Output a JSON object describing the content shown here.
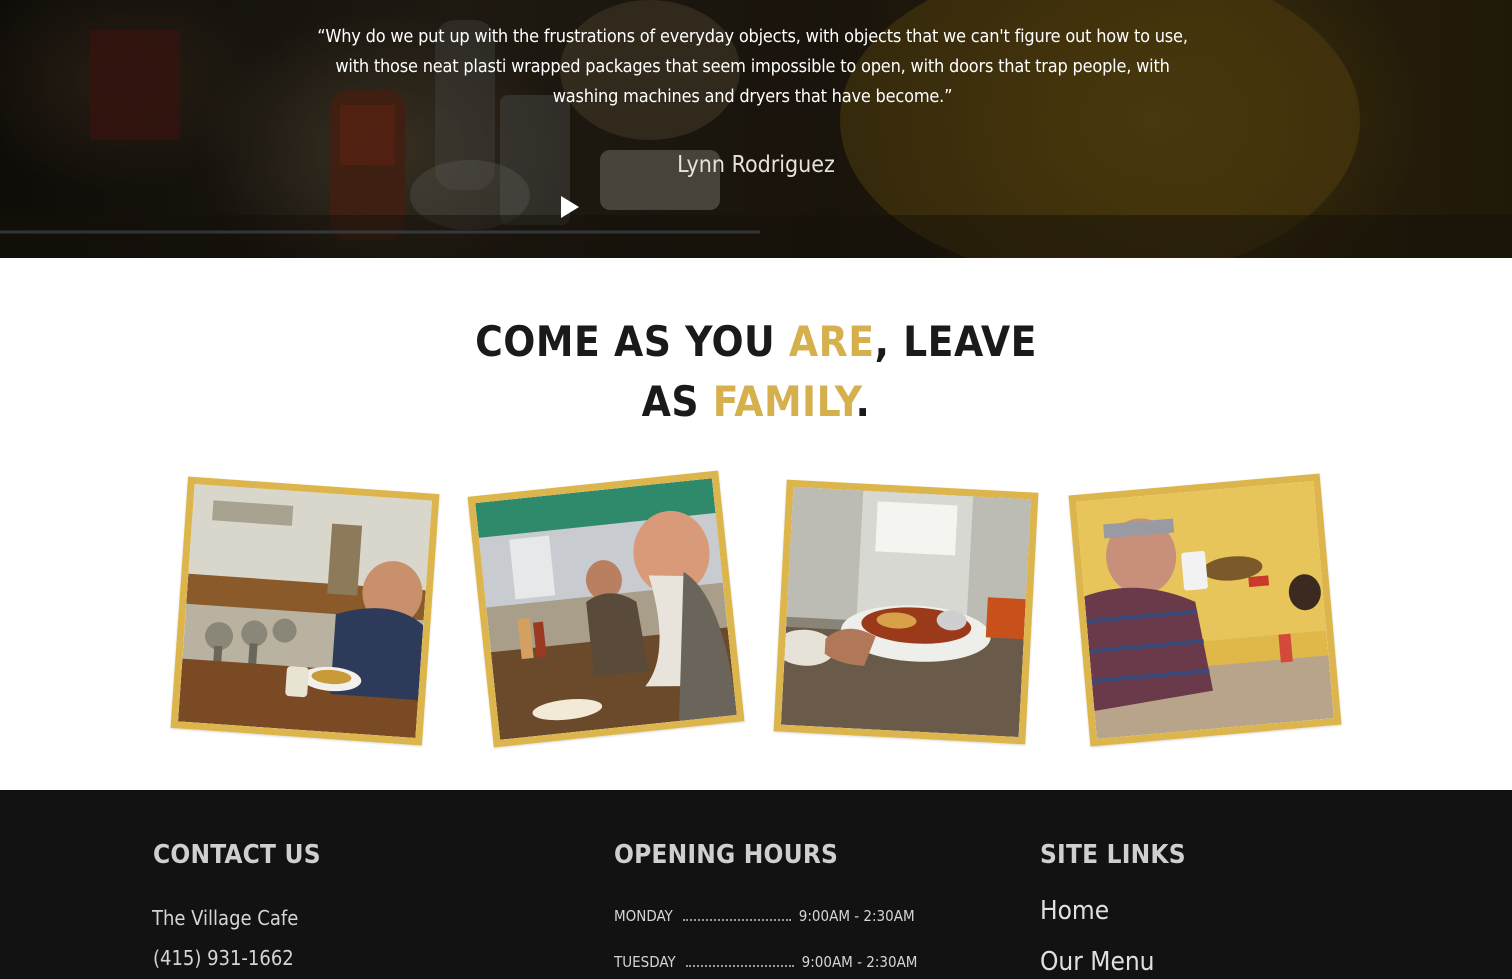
{
  "testimonial": {
    "quote": "“Why do we put up with the frustrations of everyday objects, with objects that we can't figure out how to use, with those neat plasti wrapped packages that seem impossible to open, with doors that trap people, with washing machines and dryers that have become.”",
    "author": "Lynn Rodriguez"
  },
  "headline": {
    "part1": "COME AS YOU ",
    "accent1": "ARE",
    "part2": ", LEAVE",
    "part3": "AS ",
    "accent2": "FAMILY",
    "part4": "."
  },
  "gallery": {
    "photos": [
      {
        "subject": "man eating at diner counter"
      },
      {
        "subject": "bearded man at counter"
      },
      {
        "subject": "server holding plate of food"
      },
      {
        "subject": "man drinking from cup"
      }
    ]
  },
  "footer": {
    "contact": {
      "heading": "CONTACT US",
      "name": "The Village Cafe",
      "phone": "(415) 931-1662"
    },
    "hours": {
      "heading": "OPENING HOURS",
      "rows": [
        {
          "day": "MONDAY",
          "time": "9:00AM - 2:30AM"
        },
        {
          "day": "TUESDAY",
          "time": "9:00AM - 2:30AM"
        }
      ]
    },
    "links": {
      "heading": "SITE LINKS",
      "items": [
        "Home",
        "Our Menu"
      ]
    }
  },
  "colors": {
    "accent": "#d6b04c",
    "frame": "#dcb54c",
    "footer_bg": "#121212"
  }
}
